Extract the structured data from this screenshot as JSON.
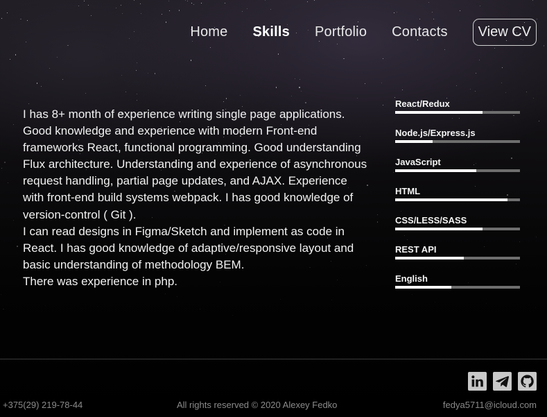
{
  "nav": {
    "items": [
      {
        "label": "Home"
      },
      {
        "label": "Skills"
      },
      {
        "label": "Portfolio"
      },
      {
        "label": "Contacts"
      }
    ],
    "active_index": 1,
    "cv_label": "View CV"
  },
  "about": {
    "paragraphs": [
      "I has 8+ month of experience writing single page applications. Good knowledge and experience with modern Front-end frameworks React, functional programming. Good understanding Flux architecture. Understanding and experience of asynchronous request handling, partial page updates, and AJAX. Experience with front-end build systems webpack. I has good knowledge of version-control ( Git ).",
      "I can read designs in Figma/Sketch and implement as code in React. I has good knowledge of adaptive/responsive layout and basic understanding of methodology BEM.",
      "There was experience in php."
    ]
  },
  "skills": [
    {
      "name": "React/Redux",
      "level": 0.7
    },
    {
      "name": "Node.js/Express.js",
      "level": 0.3
    },
    {
      "name": "JavaScript",
      "level": 0.65
    },
    {
      "name": "HTML",
      "level": 0.9
    },
    {
      "name": "CSS/LESS/SASS",
      "level": 0.7
    },
    {
      "name": "REST API",
      "level": 0.55
    },
    {
      "name": "English",
      "level": 0.45
    }
  ],
  "footer": {
    "phone": "+375(29) 219-78-44",
    "copyright": "All rights reserved © 2020 Alexey Fedko",
    "email": "fedya5711@icloud.com",
    "socials": [
      {
        "icon": "linkedin-icon"
      },
      {
        "icon": "telegram-icon"
      },
      {
        "icon": "github-icon"
      }
    ]
  },
  "colors": {
    "track": "#6e6e6e",
    "fill": "#ffffff",
    "social_bg": "#c9c9c9"
  }
}
